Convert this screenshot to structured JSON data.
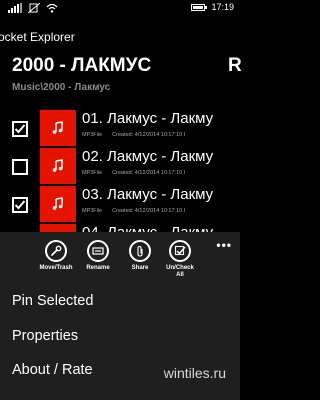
{
  "status_bar": {
    "time": "17:19"
  },
  "app": {
    "title": "ocket Explorer",
    "page_title": "2000 - ЛАКМУС",
    "next_page_peek": "R",
    "breadcrumb": "Music\\2000 - Лакмус"
  },
  "files": [
    {
      "name": "01. Лакмус - Лакму",
      "type": "MP3File",
      "created": "Created: 4/12/2014 10:17:10 I",
      "checked": true
    },
    {
      "name": "02. Лакмус - Лакму",
      "type": "MP3File",
      "created": "Created: 4/12/2014 10:17:10 I",
      "checked": false
    },
    {
      "name": "03. Лакмус - Лакму",
      "type": "MP3File",
      "created": "Created: 4/12/2014 10:17:10 I",
      "checked": true
    },
    {
      "name": "04. Лакмус - Лакму",
      "type": "",
      "created": "",
      "checked": false
    }
  ],
  "app_bar": {
    "buttons": [
      {
        "line1": "Move/Trash",
        "line2": "",
        "icon": "wrench-icon"
      },
      {
        "line1": "Rename",
        "line2": "",
        "icon": "rename-icon"
      },
      {
        "line1": "Share",
        "line2": "",
        "icon": "paperclip-icon"
      },
      {
        "line1": "Un/Check",
        "line2": "All",
        "icon": "check-all-icon"
      }
    ],
    "more": "•••",
    "menu": [
      "Pin Selected",
      "Properties",
      "About / Rate"
    ]
  },
  "watermark": "wintiles.ru",
  "colors": {
    "accent": "#e51400",
    "background": "#000000",
    "appbar": "#1f1f1f",
    "subtext": "#8a8a8a"
  }
}
